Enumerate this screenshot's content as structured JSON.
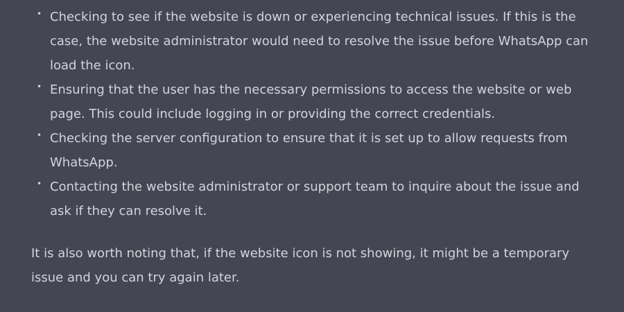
{
  "message": {
    "bullets": [
      {
        "marker": "•",
        "text": "Checking to see if the website is down or experiencing technical issues. If this is the case, the website administrator would need to resolve the issue before WhatsApp can load the icon."
      },
      {
        "marker": "•",
        "text": "Ensuring that the user has the necessary permissions to access the website or web page. This could include logging in or providing the correct credentials."
      },
      {
        "marker": "•",
        "text": "Checking the server configuration to ensure that it is set up to allow requests from WhatsApp."
      },
      {
        "marker": "•",
        "text": "Contacting the website administrator or support team to inquire about the issue and ask if they can resolve it."
      }
    ],
    "closing": "It is also worth noting that, if the website icon is not showing, it might be a temporary issue and you can try again later."
  },
  "colors": {
    "background": "#444654",
    "text": "#d1d5db"
  }
}
